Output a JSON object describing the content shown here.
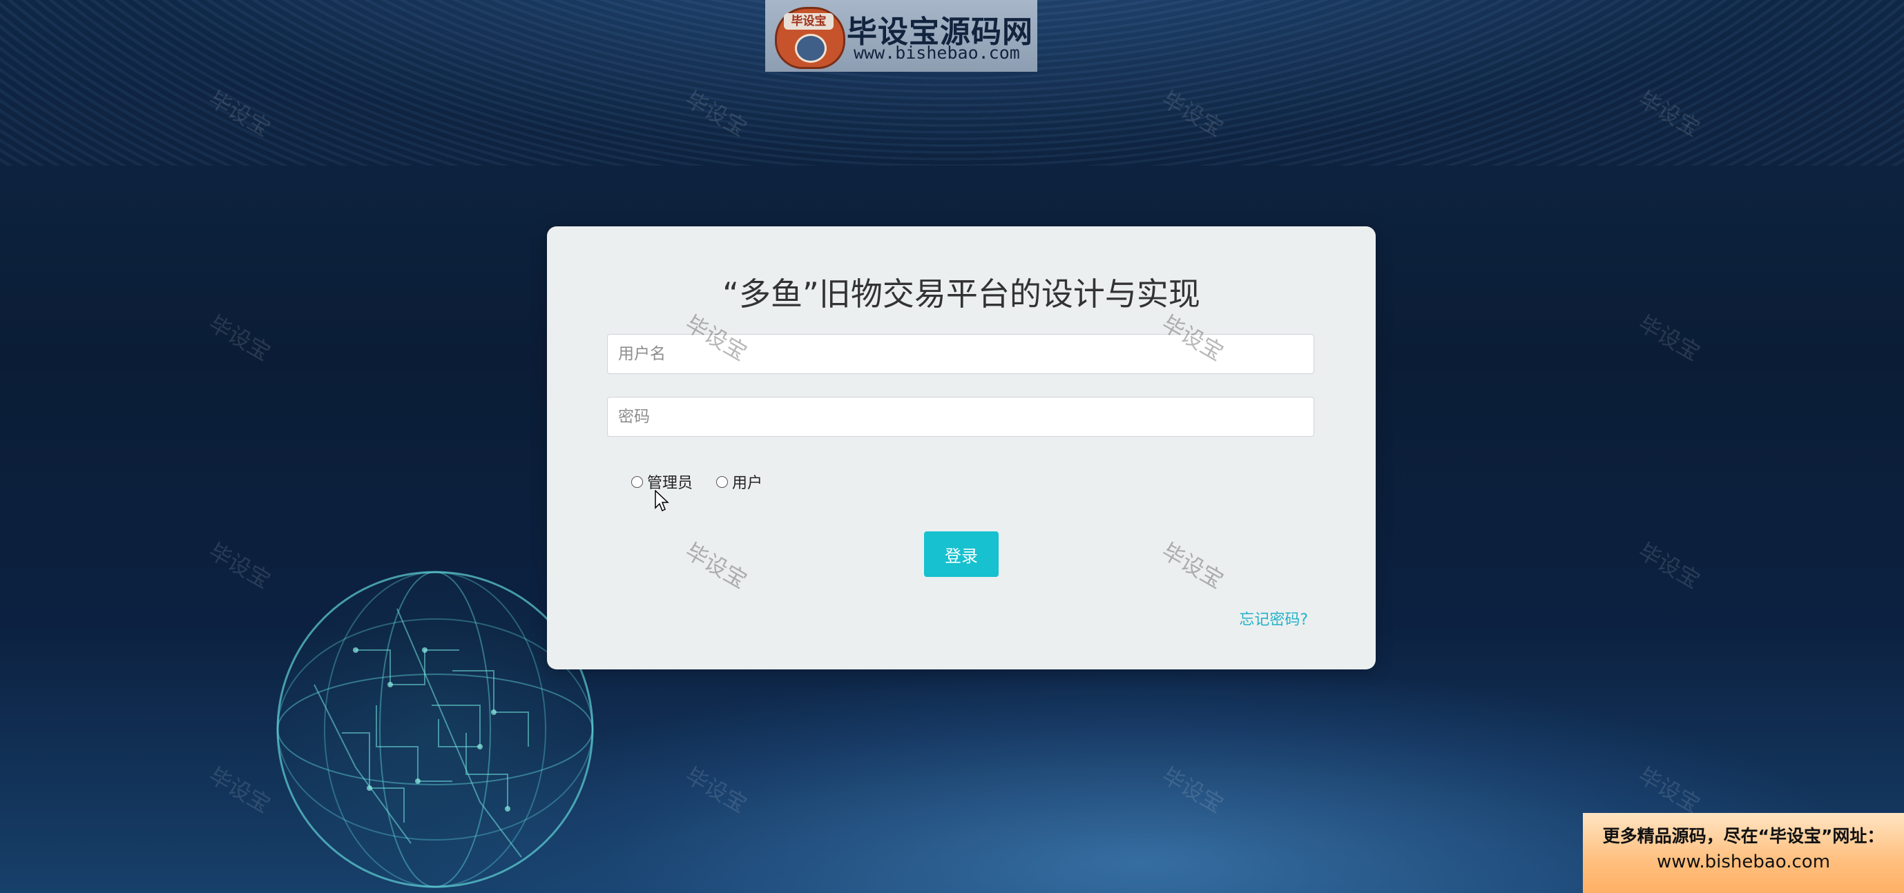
{
  "logo": {
    "badge": "毕设宝",
    "title": "毕设宝源码网",
    "url": "www.bishebao.com"
  },
  "watermark": "毕设宝",
  "login": {
    "title": "“多鱼”旧物交易平台的设计与实现",
    "username_placeholder": "用户名",
    "password_placeholder": "密码",
    "roles": [
      "管理员",
      "用户"
    ],
    "submit_label": "登录",
    "forgot_label": "忘记密码?"
  },
  "promo": {
    "line1": "更多精品源码，尽在“毕设宝”网址：",
    "line2": "www.bishebao.com"
  },
  "colors": {
    "accent": "#17c1cf",
    "link": "#22b3c8",
    "background": "#0c2141"
  }
}
